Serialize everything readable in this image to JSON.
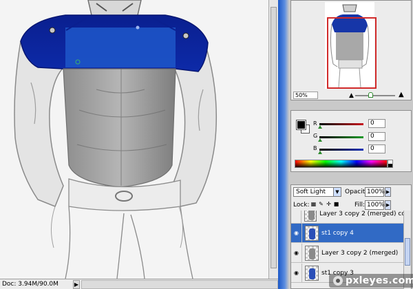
{
  "status_bar": {
    "doc_size": "Doc: 3.94M/90.0M",
    "arrow": "▶"
  },
  "navigator": {
    "zoom": "50%",
    "zoom_out_icon": "mountain-small-icon",
    "zoom_in_icon": "mountain-large-icon",
    "view_box_color": "#d12a2a"
  },
  "color": {
    "foreground": "#000000",
    "background": "#ffffff",
    "channels": [
      {
        "label": "R",
        "value": "0",
        "track_color": "#c8141e"
      },
      {
        "label": "G",
        "value": "0",
        "track_color": "#1f9b2b"
      },
      {
        "label": "B",
        "value": "0",
        "track_color": "#1734b8"
      }
    ]
  },
  "layers": {
    "blend_mode": "Soft Light",
    "opacity_label": "Opacity:",
    "opacity_value": "100%",
    "lock_label": "Lock:",
    "fill_label": "Fill:",
    "fill_value": "100%",
    "rows": [
      {
        "name": "Layer 3 copy 2 (merged) co...",
        "visible": false,
        "active": false,
        "thumb": "gray"
      },
      {
        "name": "st1 copy 4",
        "visible": true,
        "active": true,
        "thumb": "blue"
      },
      {
        "name": "Layer 3 copy 2 (merged)",
        "visible": true,
        "active": false,
        "thumb": "gray"
      },
      {
        "name": "st1 copy 3",
        "visible": true,
        "active": false,
        "thumb": "blue"
      }
    ]
  },
  "watermark": {
    "text": "pxleyes.com"
  },
  "accent_selection": "#316ac5"
}
